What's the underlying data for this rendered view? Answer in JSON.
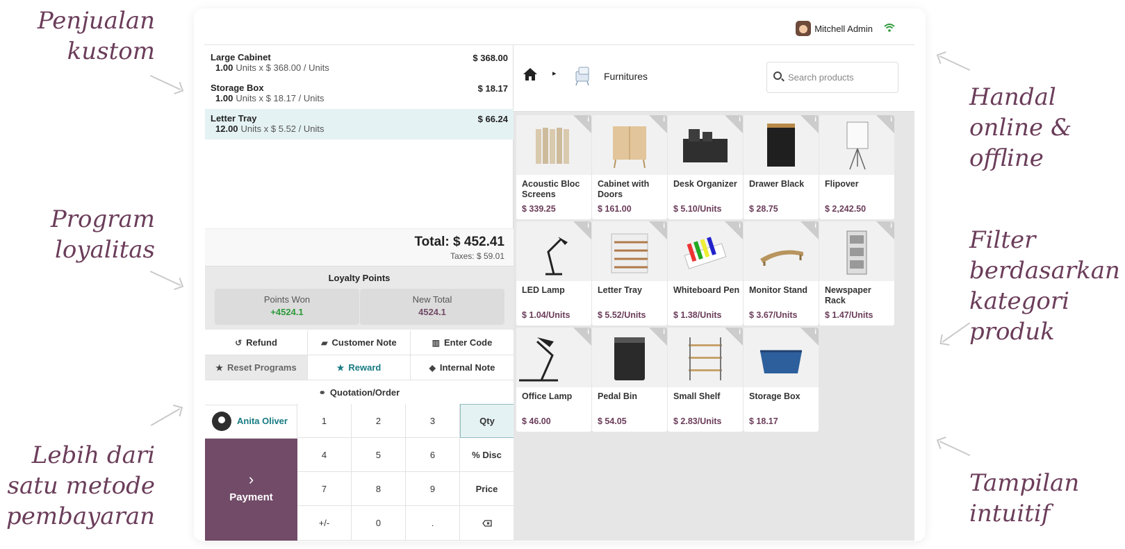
{
  "annotations": {
    "left": [
      "Penjualan kustom",
      "Program loyalitas",
      "Lebih dari satu metode pembayaran"
    ],
    "right": [
      "Handal online & offline",
      "Filter berdasarkan kategori produk",
      "Tampilan intuitif"
    ]
  },
  "header": {
    "user_name": "Mitchell Admin"
  },
  "order": {
    "lines": [
      {
        "name": "Large Cabinet",
        "qty": "1.00",
        "unit_info": "Units x $ 368.00 / Units",
        "price": "$ 368.00"
      },
      {
        "name": "Storage Box",
        "qty": "1.00",
        "unit_info": "Units x $ 18.17 / Units",
        "price": "$ 18.17"
      },
      {
        "name": "Letter Tray",
        "qty": "12.00",
        "unit_info": "Units x $ 5.52 / Units",
        "price": "$ 66.24"
      }
    ],
    "total": "Total: $ 452.41",
    "taxes": "Taxes: $ 59.01"
  },
  "loyalty": {
    "title": "Loyalty Points",
    "points_won_label": "Points Won",
    "points_won_value": "+4524.1",
    "new_total_label": "New Total",
    "new_total_value": "4524.1"
  },
  "controls": {
    "refund": "Refund",
    "customer_note": "Customer Note",
    "enter_code": "Enter Code",
    "reset_programs": "Reset Programs",
    "reward": "Reward",
    "internal_note": "Internal Note",
    "quotation": "Quotation/Order"
  },
  "customer": "Anita Oliver",
  "payment_label": "Payment",
  "numpad": {
    "k1": "1",
    "k2": "2",
    "k3": "3",
    "k4": "4",
    "k5": "5",
    "k6": "6",
    "k7": "7",
    "k8": "8",
    "k9": "9",
    "kpm": "+/-",
    "k0": "0",
    "kdot": ".",
    "qty": "Qty",
    "disc": "% Disc",
    "price": "Price"
  },
  "category": {
    "name": "Furnitures"
  },
  "search": {
    "placeholder": "Search products"
  },
  "products": [
    {
      "name": "Acoustic Bloc Screens",
      "price": "$ 339.25"
    },
    {
      "name": "Cabinet with Doors",
      "price": "$ 161.00"
    },
    {
      "name": "Desk Organizer",
      "price": "$ 5.10/Units"
    },
    {
      "name": "Drawer Black",
      "price": "$ 28.75"
    },
    {
      "name": "Flipover",
      "price": "$ 2,242.50"
    },
    {
      "name": "LED Lamp",
      "price": "$ 1.04/Units"
    },
    {
      "name": "Letter Tray",
      "price": "$ 5.52/Units"
    },
    {
      "name": "Whiteboard Pen",
      "price": "$ 1.38/Units"
    },
    {
      "name": "Monitor Stand",
      "price": "$ 3.67/Units"
    },
    {
      "name": "Newspaper Rack",
      "price": "$ 1.47/Units"
    },
    {
      "name": "Office Lamp",
      "price": "$ 46.00"
    },
    {
      "name": "Pedal Bin",
      "price": "$ 54.05"
    },
    {
      "name": "Small Shelf",
      "price": "$ 2.83/Units"
    },
    {
      "name": "Storage Box",
      "price": "$ 18.17"
    }
  ],
  "colors": {
    "brand": "#714b67",
    "accent": "#167a82",
    "points": "#2e9a3a"
  }
}
